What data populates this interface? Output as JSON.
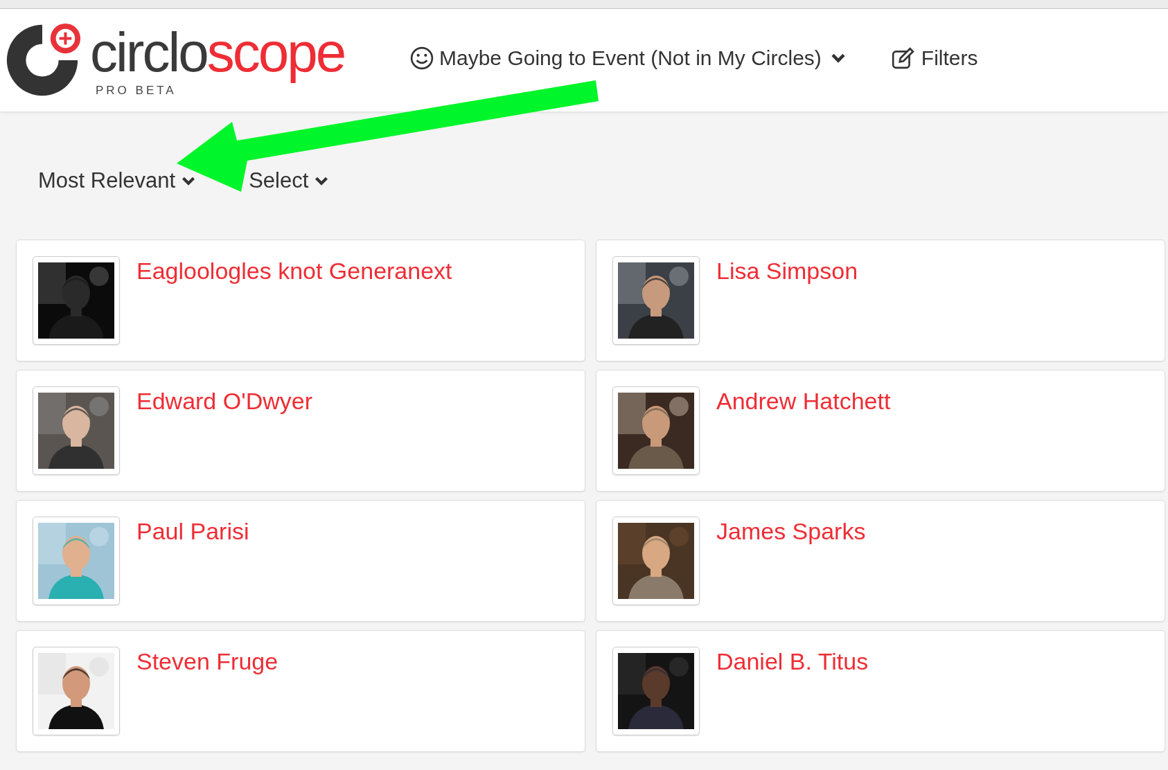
{
  "logo": {
    "wordmark": [
      "circlo",
      "scope"
    ],
    "tagline": "PRO BETA"
  },
  "nav": [
    {
      "kind": "menu",
      "label": "Maybe Going to Event (Not in My Circles)"
    },
    {
      "kind": "filters",
      "label": "Filters"
    }
  ],
  "toolbar": [
    {
      "label": "Most Relevant"
    },
    {
      "label": "Select"
    }
  ],
  "people": [
    {
      "name": "Eagloologles knot Generanext"
    },
    {
      "name": "Lisa Simpson"
    },
    {
      "name": "Edward O'Dwyer"
    },
    {
      "name": "Andrew Hatchett"
    },
    {
      "name": "Paul Parisi"
    },
    {
      "name": "James Sparks"
    },
    {
      "name": "Steven Fruge"
    },
    {
      "name": "Daniel B. Titus"
    }
  ],
  "annotation": {
    "kind": "arrow"
  }
}
